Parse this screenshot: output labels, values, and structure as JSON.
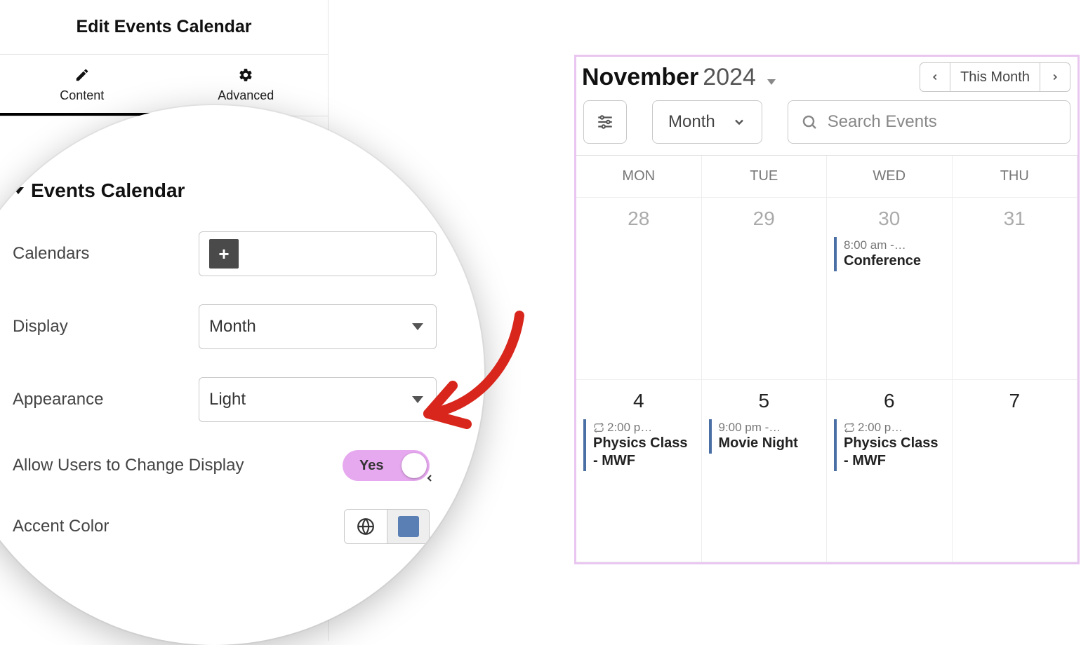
{
  "panel": {
    "title": "Edit Events Calendar",
    "tabs": {
      "content": "Content",
      "advanced": "Advanced"
    }
  },
  "section": {
    "heading": "Events Calendar",
    "calendars_label": "Calendars",
    "display_label": "Display",
    "display_value": "Month",
    "appearance_label": "Appearance",
    "appearance_value": "Light",
    "allow_label": "Allow Users to Change Display",
    "toggle_value": "Yes",
    "accent_label": "Accent Color",
    "accent_swatch": "#5a7fb5"
  },
  "calendar": {
    "month": "November",
    "year": "2024",
    "this_month": "This Month",
    "view_label": "Month",
    "search_placeholder": "Search Events",
    "day_headers": [
      "MON",
      "TUE",
      "WED",
      "THU"
    ],
    "row1": [
      {
        "num": "28",
        "prev": true
      },
      {
        "num": "29",
        "prev": true
      },
      {
        "num": "30",
        "prev": true,
        "event": {
          "time": "8:00 am -…",
          "title": "Conference"
        }
      },
      {
        "num": "31",
        "prev": true
      }
    ],
    "row2": [
      {
        "num": "4",
        "event": {
          "time": "2:00 p…",
          "title": "Physics Class - MWF",
          "repeat": true
        }
      },
      {
        "num": "5",
        "event": {
          "time": "9:00 pm -…",
          "title": "Movie Night"
        }
      },
      {
        "num": "6",
        "event": {
          "time": "2:00 p…",
          "title": "Physics Class - MWF",
          "repeat": true
        }
      },
      {
        "num": "7"
      }
    ]
  }
}
